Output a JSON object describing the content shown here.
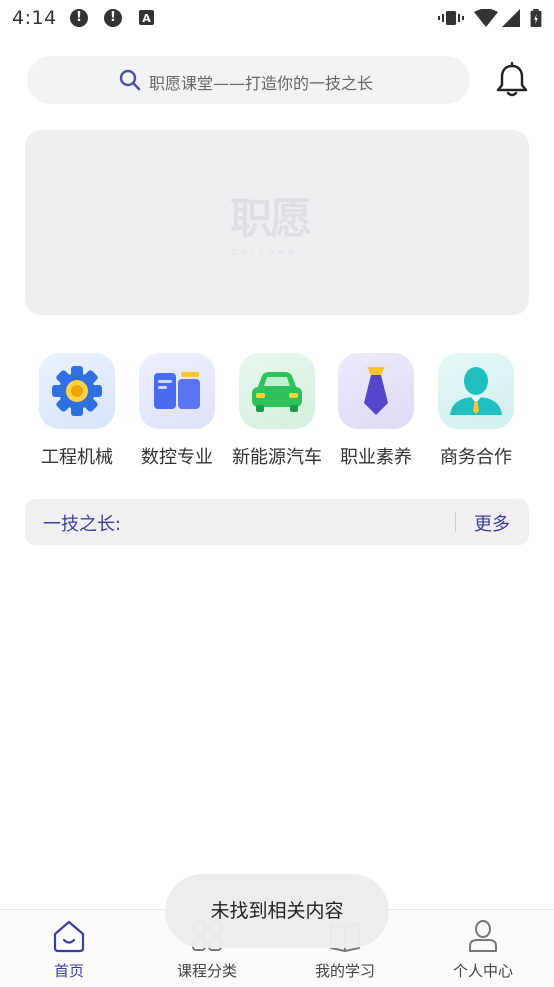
{
  "status_bar": {
    "time": "4:14"
  },
  "search": {
    "placeholder": "职愿课堂——打造你的一技之长"
  },
  "banner": {
    "logo_text": "职愿",
    "logo_sub": "ZHIYUAN"
  },
  "categories": [
    {
      "label": "工程机械",
      "icon": "gear-icon"
    },
    {
      "label": "数控专业",
      "icon": "cnc-machine-icon"
    },
    {
      "label": "新能源汽车",
      "icon": "car-icon"
    },
    {
      "label": "职业素养",
      "icon": "necktie-icon"
    },
    {
      "label": "商务合作",
      "icon": "businessman-icon"
    }
  ],
  "section": {
    "title": "一技之长:",
    "more": "更多"
  },
  "bottom_nav": [
    {
      "label": "首页",
      "icon": "home-icon",
      "active": true
    },
    {
      "label": "课程分类",
      "icon": "grid-icon",
      "active": false
    },
    {
      "label": "我的学习",
      "icon": "book-icon",
      "active": false
    },
    {
      "label": "个人中心",
      "icon": "user-icon",
      "active": false
    }
  ],
  "toast": {
    "text": "未找到相关内容"
  },
  "colors": {
    "accent": "#3a3f9f",
    "banner_bg": "#efeff2"
  }
}
